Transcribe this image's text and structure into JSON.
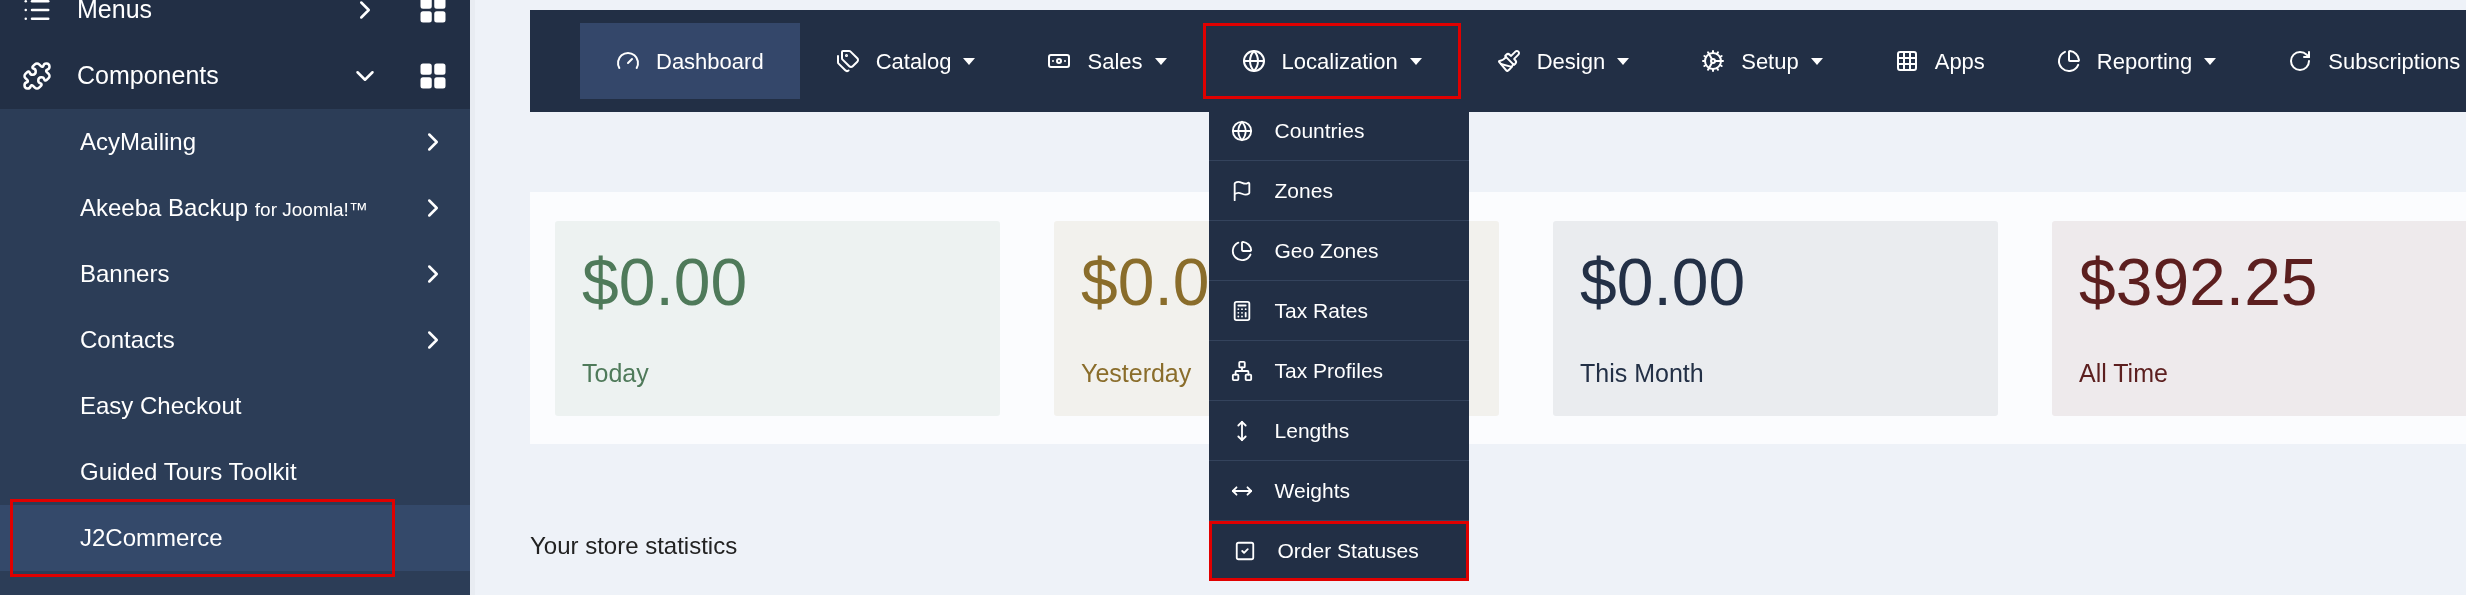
{
  "sidebar": {
    "top_items": [
      {
        "label": "Menus",
        "expanded": false
      },
      {
        "label": "Components",
        "expanded": true
      }
    ],
    "items": [
      {
        "label": "AcyMailing",
        "submenu": true,
        "selected": false
      },
      {
        "label": "Akeeba Backup **for Joomla!™**",
        "submenu": true,
        "selected": false
      },
      {
        "label": "Banners",
        "submenu": true,
        "selected": false
      },
      {
        "label": "Contacts",
        "submenu": true,
        "selected": false
      },
      {
        "label": "Easy Checkout",
        "submenu": false,
        "selected": false
      },
      {
        "label": "Guided Tours Toolkit",
        "submenu": false,
        "selected": false
      },
      {
        "label": "J2Commerce",
        "submenu": false,
        "selected": true
      }
    ]
  },
  "navbar": {
    "items": [
      {
        "label": "Dashboard",
        "dropdown": false,
        "selected": true,
        "open": false
      },
      {
        "label": "Catalog",
        "dropdown": true,
        "selected": false,
        "open": false
      },
      {
        "label": "Sales",
        "dropdown": true,
        "selected": false,
        "open": false
      },
      {
        "label": "Localization",
        "dropdown": true,
        "selected": false,
        "open": true
      },
      {
        "label": "Design",
        "dropdown": true,
        "selected": false,
        "open": false
      },
      {
        "label": "Setup",
        "dropdown": true,
        "selected": false,
        "open": false
      },
      {
        "label": "Apps",
        "dropdown": false,
        "selected": false,
        "open": false
      },
      {
        "label": "Reporting",
        "dropdown": true,
        "selected": false,
        "open": false
      },
      {
        "label": "Subscriptions",
        "dropdown": false,
        "selected": false,
        "open": false
      }
    ],
    "dropdown_items": [
      {
        "label": "Countries",
        "selected": false
      },
      {
        "label": "Zones",
        "selected": false
      },
      {
        "label": "Geo Zones",
        "selected": false
      },
      {
        "label": "Tax Rates",
        "selected": false
      },
      {
        "label": "Tax Profiles",
        "selected": false
      },
      {
        "label": "Lengths",
        "selected": false
      },
      {
        "label": "Weights",
        "selected": false
      },
      {
        "label": "Order Statuses",
        "selected": true
      }
    ]
  },
  "stats": [
    {
      "amount": "$0.00",
      "label": "Today",
      "color": "#4f7a5a"
    },
    {
      "amount": "$0.0",
      "label": "Yesterday",
      "color": "#8a6d2b"
    },
    {
      "amount": "$0.00",
      "label": "This Month",
      "color": "#233046"
    },
    {
      "amount": "$392.25",
      "label": "All Time",
      "color": "#5c1f1f"
    }
  ],
  "section_title": "Your store statistics"
}
